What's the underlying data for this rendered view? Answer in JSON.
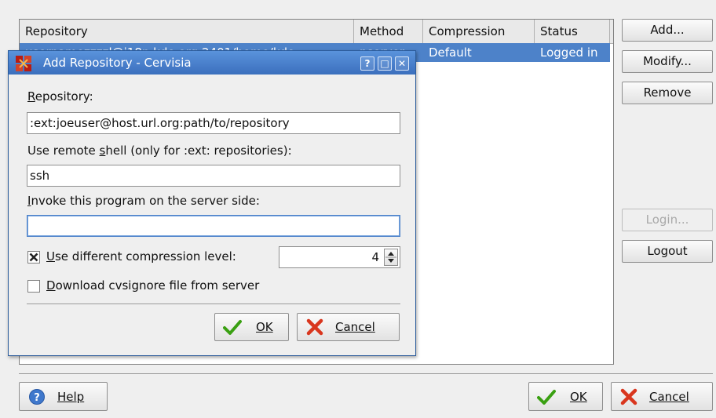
{
  "table": {
    "columns": [
      "Repository",
      "Method",
      "Compression",
      "Status"
    ],
    "row": {
      "repository": "usernamezzzzl@i18n.kde.org:2401/home/kde",
      "method": "pserver",
      "compression": "Default",
      "status": "Logged in"
    }
  },
  "side_buttons": {
    "add": "Add...",
    "modify": "Modify...",
    "remove": "Remove",
    "login": "Login...",
    "logout": "Logout"
  },
  "bottom": {
    "help": "Help",
    "ok": "OK",
    "cancel": "Cancel"
  },
  "dialog": {
    "title": "Add Repository - Cervisia",
    "titlebar_buttons": {
      "help": "?",
      "maximize": "□",
      "close": "✕"
    },
    "repository_label": "Repository:",
    "repository_value": ":ext:joeuser@host.url.org:path/to/repository",
    "rsh_label": "Use remote shell (only for :ext: repositories):",
    "rsh_value": "ssh",
    "server_label": "Invoke this program on the server side:",
    "server_value": "",
    "compression_label": "Use different compression level:",
    "compression_checked": true,
    "compression_value": "4",
    "cvsignore_label": "Download cvsignore file from server",
    "cvsignore_checked": false,
    "ok": "OK",
    "cancel": "Cancel"
  },
  "colors": {
    "selection": "#4d82c9",
    "titlebar": "#4a83cf",
    "ok_check": "#3aa012",
    "cancel_x": "#d9361e",
    "help_icon": "#3f78cc"
  }
}
